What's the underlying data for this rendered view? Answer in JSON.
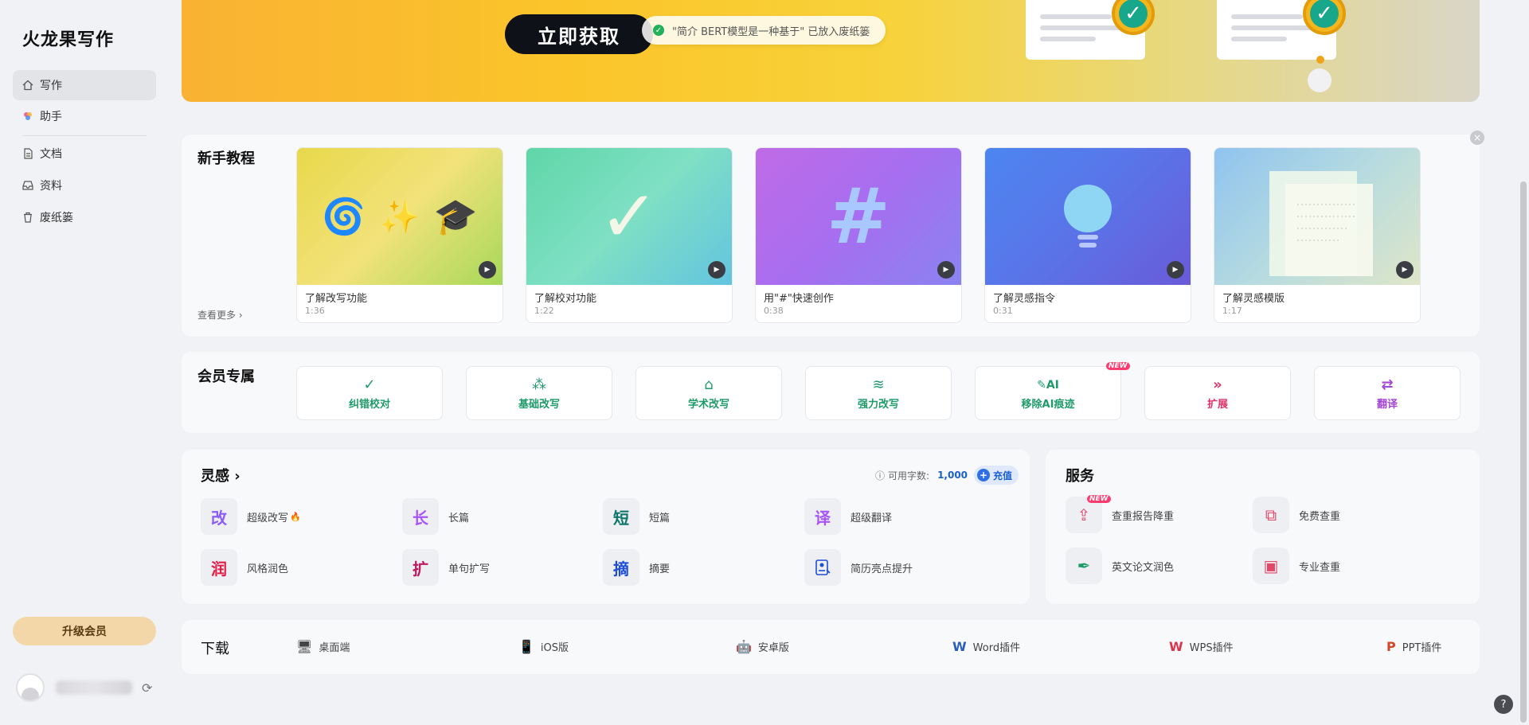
{
  "sidebar": {
    "logo": "火龙果写作",
    "items": [
      {
        "label": "写作",
        "icon": "home-icon"
      },
      {
        "label": "助手",
        "icon": "assistant-icon"
      },
      {
        "label": "文档",
        "icon": "document-icon"
      },
      {
        "label": "资料",
        "icon": "inbox-icon"
      },
      {
        "label": "废纸篓",
        "icon": "trash-icon"
      }
    ],
    "upgrade_label": "升级会员"
  },
  "banner": {
    "cta_label": "立即获取",
    "toast_text": "\"简介 BERT模型是一种基于\" 已放入废纸篓"
  },
  "tutorials": {
    "title": "新手教程",
    "see_more": "查看更多 ›",
    "cards": [
      {
        "title": "了解改写功能",
        "duration": "1:36"
      },
      {
        "title": "了解校对功能",
        "duration": "1:22"
      },
      {
        "title": "用\"#\"快速创作",
        "duration": "0:38"
      },
      {
        "title": "了解灵感指令",
        "duration": "0:31"
      },
      {
        "title": "了解灵感模版",
        "duration": "1:17"
      }
    ]
  },
  "vip": {
    "title": "会员专属",
    "items": [
      {
        "label": "纠错校对",
        "icon": "check-icon",
        "color": "#1f9a6b"
      },
      {
        "label": "基础改写",
        "icon": "magic-wand-icon",
        "color": "#1f9a6b"
      },
      {
        "label": "学术改写",
        "icon": "graduation-cap-icon",
        "color": "#1f9a6b"
      },
      {
        "label": "强力改写",
        "icon": "tornado-icon",
        "color": "#1f9a6b"
      },
      {
        "label": "移除AI痕迹",
        "icon": "ai-eraser-icon",
        "color": "#1f9a6b"
      },
      {
        "label": "扩展",
        "icon": "double-chevron-icon",
        "color": "#e0336a"
      },
      {
        "label": "翻译",
        "icon": "swap-arrows-icon",
        "color": "#a546d4"
      }
    ],
    "new_badge": "NEW"
  },
  "inspiration": {
    "title": "灵感 ›",
    "quota_label": "可用字数:",
    "quota_value": "1,000",
    "recharge_label": "充值",
    "items": [
      {
        "glyph": "改",
        "label": "超级改写",
        "color": "#8b5cf6"
      },
      {
        "glyph": "长",
        "label": "长篇",
        "color": "#a855f7"
      },
      {
        "glyph": "短",
        "label": "短篇",
        "color": "#0f766e"
      },
      {
        "glyph": "译",
        "label": "超级翻译",
        "color": "#a855f7"
      },
      {
        "glyph": "润",
        "label": "风格润色",
        "color": "#e11d48"
      },
      {
        "glyph": "扩",
        "label": "单句扩写",
        "color": "#be185d"
      },
      {
        "glyph": "摘",
        "label": "摘要",
        "color": "#1d4ed8"
      },
      {
        "glyph": "",
        "label": "简历亮点提升",
        "color": "#1d4ed8"
      }
    ]
  },
  "services": {
    "title": "服务",
    "items": [
      {
        "label": "查重报告降重",
        "icon": "upload-icon"
      },
      {
        "label": "免费查重",
        "icon": "copy-icon"
      },
      {
        "label": "英文论文润色",
        "icon": "feather-icon"
      },
      {
        "label": "专业查重",
        "icon": "layout-icon"
      }
    ],
    "new_badge": "NEW"
  },
  "download": {
    "title": "下载",
    "items": [
      {
        "label": "桌面端",
        "icon": "desktop-icon"
      },
      {
        "label": "iOS版",
        "icon": "ios-icon"
      },
      {
        "label": "安卓版",
        "icon": "android-icon"
      },
      {
        "label": "Word插件",
        "icon": "word-icon"
      },
      {
        "label": "WPS插件",
        "icon": "wps-icon"
      },
      {
        "label": "PPT插件",
        "icon": "ppt-icon"
      }
    ]
  },
  "help": "?"
}
